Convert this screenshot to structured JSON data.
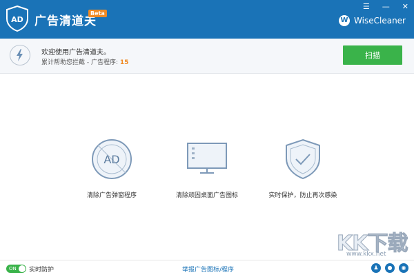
{
  "app": {
    "title": "广告清道夫",
    "badge": "Beta",
    "brand": "WiseCleaner",
    "brand_initial": "W"
  },
  "window_controls": {
    "menu": "☰",
    "minimize": "—",
    "close": "✕"
  },
  "info": {
    "welcome": "欢迎使用广告清道夫。",
    "stats_label": "累计帮助您拦截 -   广告程序:",
    "stats_count": "15",
    "scan_button": "扫描"
  },
  "features": [
    {
      "label": "清除广告弹窗程序",
      "icon": "ad-block-icon",
      "icon_text": "AD"
    },
    {
      "label": "清除顽固桌面广告图标",
      "icon": "monitor-icon"
    },
    {
      "label": "实时保护，防止再次感染",
      "icon": "shield-check-icon"
    }
  ],
  "statusbar": {
    "toggle_label": "ON",
    "realtime_label": "实时防护",
    "report_link": "举报广告图标/程序"
  },
  "watermark": {
    "text": "KK下载",
    "sub": "www.kkx.net"
  },
  "colors": {
    "titlebar": "#1a73b7",
    "accent_green": "#3ab34a",
    "accent_orange": "#f08a24"
  }
}
